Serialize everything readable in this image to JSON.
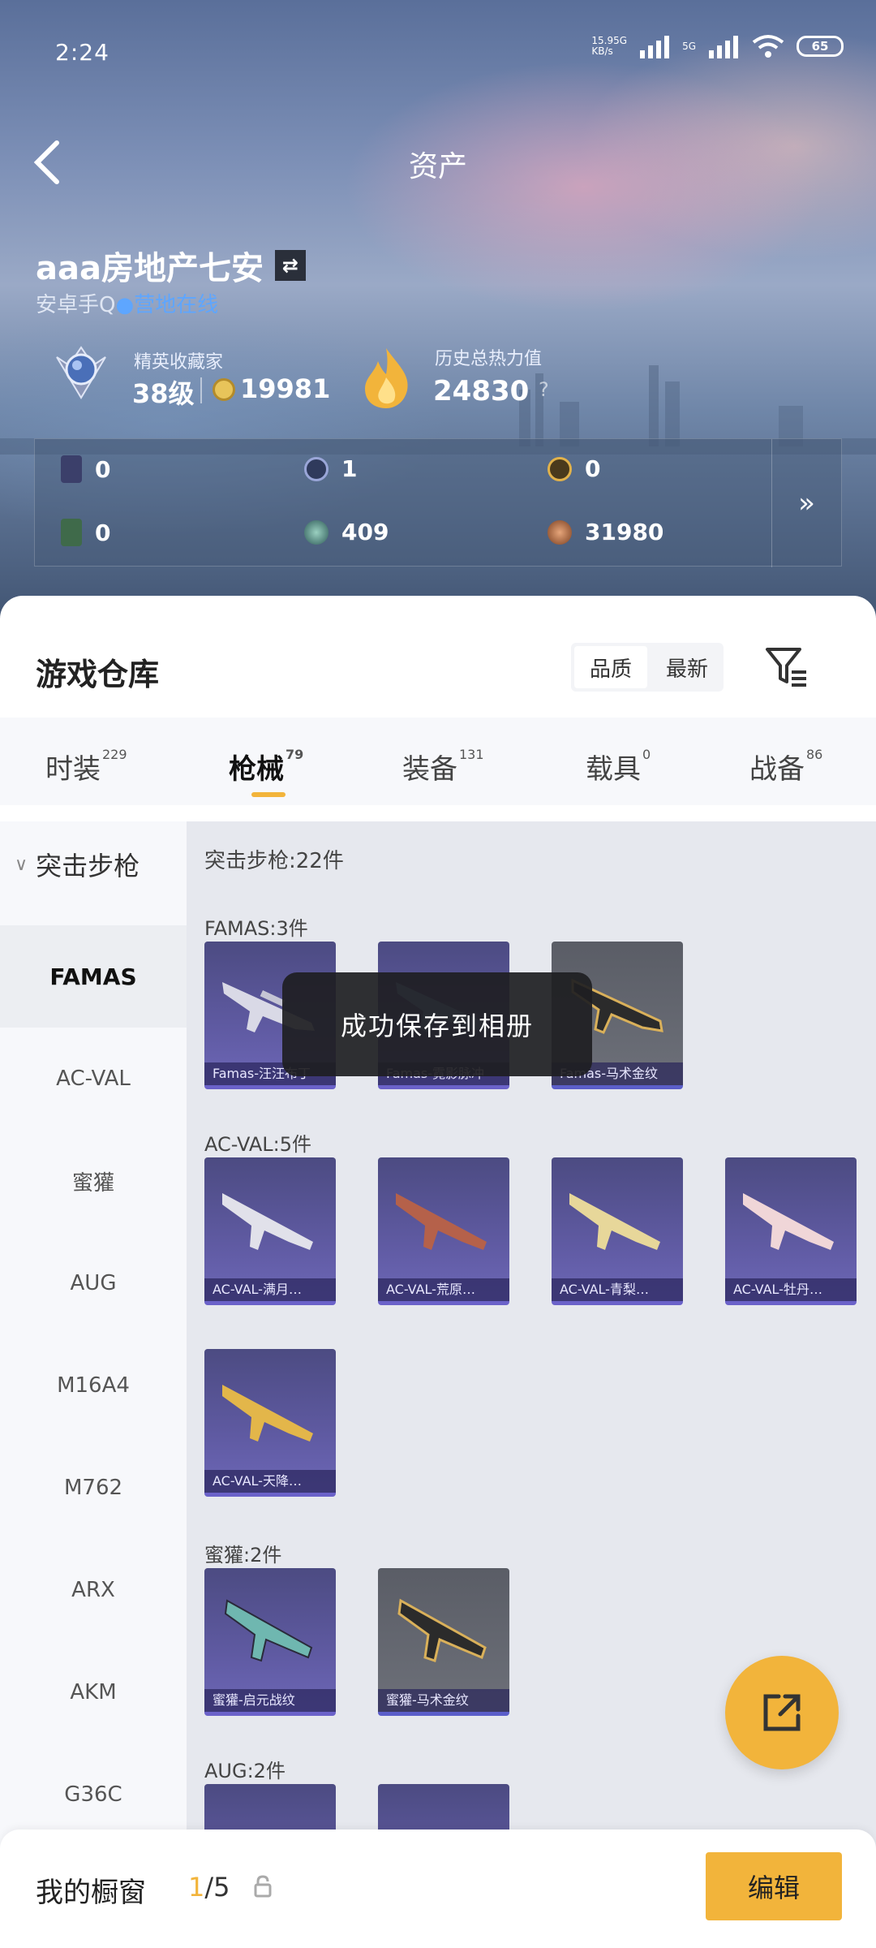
{
  "status_bar": {
    "time": "2:24",
    "net_speed_top": "15.95G",
    "net_speed_bottom": "KB/s",
    "network": "5G",
    "battery": "65"
  },
  "header": {
    "title": "资产",
    "username": "aaa房地产七安",
    "subline_prefix": "安卓手Q",
    "subline_status": "●营地在线"
  },
  "stats": {
    "rank_label": "精英收藏家",
    "rank_level": "38级",
    "coins": "19981",
    "heat_label": "历史总热力值",
    "heat_value": "24830",
    "help": "?"
  },
  "resources": [
    {
      "icon": "purple-card-icon",
      "value": "0"
    },
    {
      "icon": "blue-token-icon",
      "value": "1"
    },
    {
      "icon": "gold-token-icon",
      "value": "0"
    },
    {
      "icon": "green-card-icon",
      "value": "0"
    },
    {
      "icon": "teal-orb-icon",
      "value": "409"
    },
    {
      "icon": "bronze-orb-icon",
      "value": "31980"
    }
  ],
  "warehouse": {
    "title": "游戏仓库",
    "sort_options": [
      "品质",
      "最新"
    ],
    "sort_active": "品质"
  },
  "tabs": [
    {
      "label": "时装",
      "count": "229"
    },
    {
      "label": "枪械",
      "count": "79"
    },
    {
      "label": "装备",
      "count": "131"
    },
    {
      "label": "载具",
      "count": "0"
    },
    {
      "label": "战备",
      "count": "86"
    }
  ],
  "sidebar": {
    "category": "突击步枪",
    "items": [
      "FAMAS",
      "AC-VAL",
      "蜜獾",
      "AUG",
      "M16A4",
      "M762",
      "ARX",
      "AKM",
      "G36C"
    ]
  },
  "content": {
    "summary": "突击步枪:22件",
    "sections": [
      {
        "title": "FAMAS:3件",
        "items": [
          "Famas-汪汪布丁",
          "Famas-霓影脉冲",
          "Famas-马术金纹"
        ]
      },
      {
        "title": "AC-VAL:5件",
        "items": [
          "AC-VAL-满月…",
          "AC-VAL-荒原…",
          "AC-VAL-青梨…",
          "AC-VAL-牡丹…",
          "AC-VAL-天降…"
        ]
      },
      {
        "title": "蜜獾:2件",
        "items": [
          "蜜獾-启元战纹",
          "蜜獾-马术金纹"
        ]
      },
      {
        "title": "AUG:2件",
        "items": []
      }
    ]
  },
  "toast": "成功保存到相册",
  "bottom_bar": {
    "label": "我的橱窗",
    "current": "1",
    "total": "/5",
    "edit": "编辑"
  }
}
